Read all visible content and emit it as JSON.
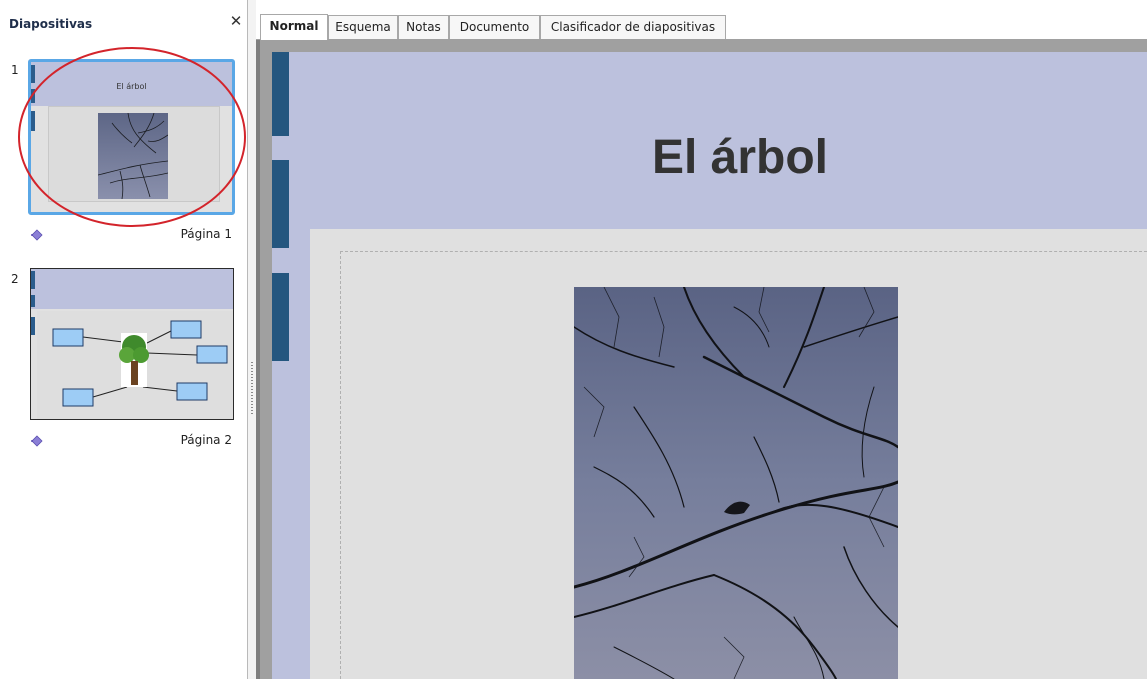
{
  "slides_pane": {
    "title": "Diapositivas",
    "close_symbol": "✕",
    "slides": [
      {
        "number": "1",
        "thumb_title": "El árbol",
        "caption": "Página 1",
        "selected": true
      },
      {
        "number": "2",
        "thumb_title": "",
        "caption": "Página 2",
        "selected": false
      }
    ],
    "highlight_color": "#d3242b",
    "selection_color": "#5aa7e6"
  },
  "tabs": [
    {
      "label": "Normal",
      "active": true
    },
    {
      "label": "Esquema",
      "active": false
    },
    {
      "label": "Notas",
      "active": false
    },
    {
      "label": "Documento",
      "active": false
    },
    {
      "label": "Clasificador de diapositivas",
      "active": false
    }
  ],
  "slide": {
    "title": "El árbol",
    "band_color": "#bcc1dd",
    "accent_bar_color": "#24567f",
    "content_bg": "#e0e0e0"
  },
  "icons": {
    "close": "close-icon",
    "slide_transition": "slide-transition-icon"
  }
}
